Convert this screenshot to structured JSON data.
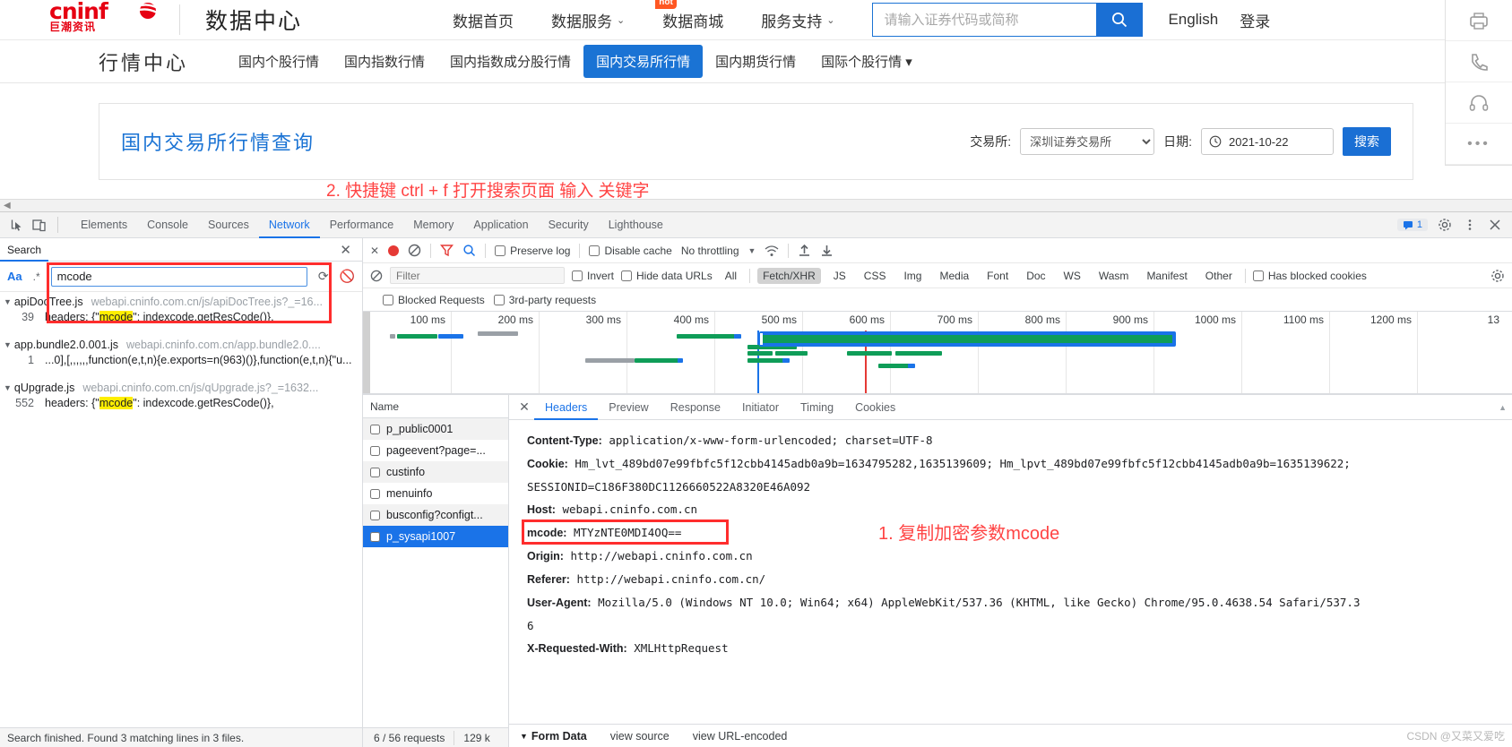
{
  "site": {
    "logo_main": "cninf",
    "logo_sub": "巨潮资讯",
    "title": "数据中心",
    "topnav": [
      {
        "label": "数据首页",
        "caret": false,
        "badge": null
      },
      {
        "label": "数据服务",
        "caret": true,
        "badge": null
      },
      {
        "label": "数据商城",
        "caret": false,
        "badge": "hot"
      },
      {
        "label": "服务支持",
        "caret": true,
        "badge": null
      }
    ],
    "search": {
      "placeholder": "请输入证券代码或简称",
      "value": "",
      "icon": "search-icon"
    },
    "language": "English",
    "login": "登录"
  },
  "subnav": {
    "title": "行情中心",
    "items": [
      {
        "label": "国内个股行情",
        "active": false
      },
      {
        "label": "国内指数行情",
        "active": false
      },
      {
        "label": "国内指数成分股行情",
        "active": false
      },
      {
        "label": "国内交易所行情",
        "active": true
      },
      {
        "label": "国内期货行情",
        "active": false
      },
      {
        "label": "国际个股行情 ▾",
        "active": false
      }
    ]
  },
  "query_panel": {
    "title": "国内交易所行情查询",
    "exchange_label": "交易所:",
    "exchange_value": "深圳证券交易所",
    "date_label": "日期:",
    "date_value": "2021-10-22",
    "search_button": "搜索"
  },
  "annotations": {
    "step2": "2. 快捷键 ctrl + f 打开搜索页面 输入 关键字",
    "step1": "1. 复制加密参数mcode",
    "color": "#ff4444"
  },
  "devtools": {
    "tabs": [
      {
        "label": "Elements",
        "active": false
      },
      {
        "label": "Console",
        "active": false
      },
      {
        "label": "Sources",
        "active": false
      },
      {
        "label": "Network",
        "active": true
      },
      {
        "label": "Performance",
        "active": false
      },
      {
        "label": "Memory",
        "active": false
      },
      {
        "label": "Application",
        "active": false
      },
      {
        "label": "Security",
        "active": false
      },
      {
        "label": "Lighthouse",
        "active": false
      }
    ],
    "message_count": "1",
    "right_icons": [
      "messages-icon",
      "gear-icon",
      "more-vertical-icon",
      "close-icon"
    ]
  },
  "search_panel": {
    "tab_label": "Search",
    "close_icon": "close-icon",
    "match_case": "Aa",
    "regex": ".*",
    "query": "mcode",
    "refresh_icon": "refresh-icon",
    "clear_icon": "clear-icon",
    "results": [
      {
        "file": "apiDocTree.js",
        "url": "webapi.cninfo.com.cn/js/apiDocTree.js?_=16...",
        "line_no": "39",
        "code_before": "headers: {\"",
        "code_match": "mcode",
        "code_after": "\": indexcode.getResCode()},"
      },
      {
        "file": "app.bundle2.0.001.js",
        "url": "webapi.cninfo.com.cn/app.bundle2.0....",
        "line_no": "1",
        "code_before": "...0],[,,,,,,function(e,t,n){e.exports=n(963)()},function(e,t,n){\"u...",
        "code_match": "",
        "code_after": ""
      },
      {
        "file": "qUpgrade.js",
        "url": "webapi.cninfo.com.cn/js/qUpgrade.js?_=1632...",
        "line_no": "552",
        "code_before": "headers: {\"",
        "code_match": "mcode",
        "code_after": "\": indexcode.getResCode()},"
      }
    ],
    "status": "Search finished. Found 3 matching lines in 3 files."
  },
  "network": {
    "toolbar": {
      "record_icon": "record-icon",
      "clear_icon": "clear-icon",
      "filter_icon": "filter-icon",
      "search_icon": "search-icon",
      "preserve_log": "Preserve log",
      "disable_cache": "Disable cache",
      "throttling": "No throttling",
      "wifi_icon": "network-conditions-icon",
      "import_icon": "import-har-icon",
      "export_icon": "export-har-icon"
    },
    "filterbar": {
      "block_icon": "block-icon",
      "filter_placeholder": "Filter",
      "invert": "Invert",
      "hide_data_urls": "Hide data URLs",
      "types": [
        {
          "label": "All",
          "selected": false
        },
        {
          "label": "Fetch/XHR",
          "selected": true
        },
        {
          "label": "JS",
          "selected": false
        },
        {
          "label": "CSS",
          "selected": false
        },
        {
          "label": "Img",
          "selected": false
        },
        {
          "label": "Media",
          "selected": false
        },
        {
          "label": "Font",
          "selected": false
        },
        {
          "label": "Doc",
          "selected": false
        },
        {
          "label": "WS",
          "selected": false
        },
        {
          "label": "Wasm",
          "selected": false
        },
        {
          "label": "Manifest",
          "selected": false
        },
        {
          "label": "Other",
          "selected": false
        }
      ],
      "has_blocked_cookies": "Has blocked cookies"
    },
    "options_row": {
      "blocked_requests": "Blocked Requests",
      "third_party": "3rd-party requests"
    },
    "timeline": {
      "ticks": [
        "100 ms",
        "200 ms",
        "300 ms",
        "400 ms",
        "500 ms",
        "600 ms",
        "700 ms",
        "800 ms",
        "900 ms",
        "1000 ms",
        "1100 ms",
        "1200 ms",
        "13"
      ]
    },
    "name_column_header": "Name",
    "requests": [
      {
        "name": "p_public0001",
        "selected": false
      },
      {
        "name": "pageevent?page=...",
        "selected": false
      },
      {
        "name": "custinfo",
        "selected": false
      },
      {
        "name": "menuinfo",
        "selected": false
      },
      {
        "name": "busconfig?configt...",
        "selected": false
      },
      {
        "name": "p_sysapi1007",
        "selected": true
      }
    ],
    "detail_tabs": [
      {
        "label": "Headers",
        "active": true
      },
      {
        "label": "Preview",
        "active": false
      },
      {
        "label": "Response",
        "active": false
      },
      {
        "label": "Initiator",
        "active": false
      },
      {
        "label": "Timing",
        "active": false
      },
      {
        "label": "Cookies",
        "active": false
      }
    ],
    "headers": [
      {
        "key": "Content-Type:",
        "value": "application/x-www-form-urlencoded; charset=UTF-8",
        "highlight": false
      },
      {
        "key": "Cookie:",
        "value": "Hm_lvt_489bd07e99fbfc5f12cbb4145adb0a9b=1634795282,1635139609; Hm_lpvt_489bd07e99fbfc5f12cbb4145adb0a9b=1635139622;",
        "highlight": false
      },
      {
        "key": "",
        "value": "SESSIONID=C186F380DC1126660522A8320E46A092",
        "highlight": false
      },
      {
        "key": "Host:",
        "value": "webapi.cninfo.com.cn",
        "highlight": false
      },
      {
        "key": "mcode:",
        "value": "MTYzNTE0MDI4OQ==",
        "highlight": true
      },
      {
        "key": "Origin:",
        "value": "http://webapi.cninfo.com.cn",
        "highlight": false
      },
      {
        "key": "Referer:",
        "value": "http://webapi.cninfo.com.cn/",
        "highlight": false
      },
      {
        "key": "User-Agent:",
        "value": "Mozilla/5.0 (Windows NT 10.0; Win64; x64) AppleWebKit/537.36 (KHTML, like Gecko) Chrome/95.0.4638.54 Safari/537.3",
        "highlight": false
      },
      {
        "key": "",
        "value": "6",
        "highlight": false
      },
      {
        "key": "X-Requested-With:",
        "value": "XMLHttpRequest",
        "highlight": false
      }
    ],
    "form_data": {
      "title": "Form Data",
      "view_source": "view source",
      "view_url_encoded": "view URL-encoded"
    },
    "status": {
      "requests": "6 / 56 requests",
      "transferred": "129 k"
    }
  },
  "watermark": "CSDN @又菜又爱吃"
}
